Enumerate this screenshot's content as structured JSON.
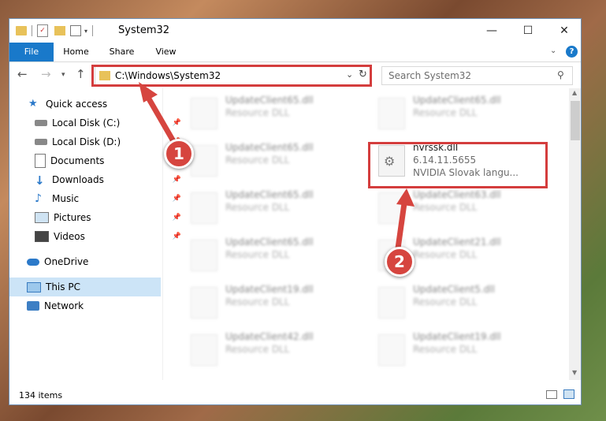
{
  "window": {
    "title": "System32"
  },
  "ribbon": {
    "tabs": [
      "File",
      "Home",
      "Share",
      "View"
    ]
  },
  "address": {
    "path": "C:\\Windows\\System32"
  },
  "search": {
    "placeholder": "Search System32"
  },
  "sidebar": {
    "items": [
      {
        "label": "Quick access",
        "icon": "star-icon"
      },
      {
        "label": "Local Disk (C:)",
        "icon": "drive-icon"
      },
      {
        "label": "Local Disk (D:)",
        "icon": "drive-icon"
      },
      {
        "label": "Documents",
        "icon": "documents-icon"
      },
      {
        "label": "Downloads",
        "icon": "download-icon"
      },
      {
        "label": "Music",
        "icon": "music-icon"
      },
      {
        "label": "Pictures",
        "icon": "pictures-icon"
      },
      {
        "label": "Videos",
        "icon": "videos-icon"
      },
      {
        "label": "OneDrive",
        "icon": "cloud-icon"
      },
      {
        "label": "This PC",
        "icon": "computer-icon"
      },
      {
        "label": "Network",
        "icon": "network-icon"
      }
    ]
  },
  "files": {
    "left": [
      {
        "name": "UpdateClient65.dll",
        "desc": "Resource DLL"
      },
      {
        "name": "UpdateClient65.dll",
        "desc": "Resource DLL"
      },
      {
        "name": "UpdateClient65.dll",
        "desc": "Resource DLL"
      },
      {
        "name": "UpdateClient65.dll",
        "desc": "Resource DLL"
      },
      {
        "name": "UpdateClient19.dll",
        "desc": "Resource DLL"
      },
      {
        "name": "UpdateClient42.dll",
        "desc": "Resource DLL"
      }
    ],
    "right": [
      {
        "name": "UpdateClient65.dll",
        "desc": "Resource DLL"
      },
      {
        "name": "UpdateClient63.dll",
        "desc": "Resource DLL"
      },
      {
        "name": "UpdateClient21.dll",
        "desc": "Resource DLL"
      },
      {
        "name": "UpdateClient5.dll",
        "desc": "Resource DLL"
      },
      {
        "name": "UpdateClient19.dll",
        "desc": "Resource DLL"
      }
    ],
    "highlighted": {
      "name": "nvrssk.dll",
      "version": "6.14.11.5655",
      "desc": "NVIDIA Slovak langu..."
    }
  },
  "status": {
    "count": "134 items"
  },
  "annotations": {
    "step1": "1",
    "step2": "2"
  },
  "colors": {
    "accent": "#1979ca",
    "highlight": "#d43d3d"
  }
}
